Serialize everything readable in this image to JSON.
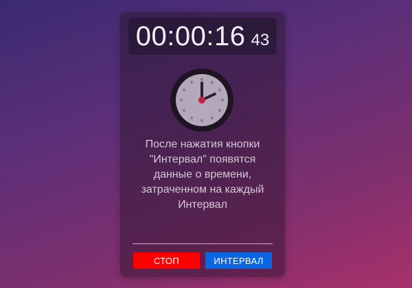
{
  "timer": {
    "time": "00:00:16",
    "ms": "43"
  },
  "help_text": [
    "После нажатия кнопки",
    "\"Интервал\" появятся",
    "данные о времени,",
    "затраченном на каждый",
    "Интервал"
  ],
  "buttons": {
    "stop_label": "СТОП",
    "interval_label": "ИНТЕРВАЛ"
  },
  "colors": {
    "stop": "#ff0000",
    "interval": "#0b66e4"
  },
  "icons": {
    "clock": "clock-icon"
  }
}
